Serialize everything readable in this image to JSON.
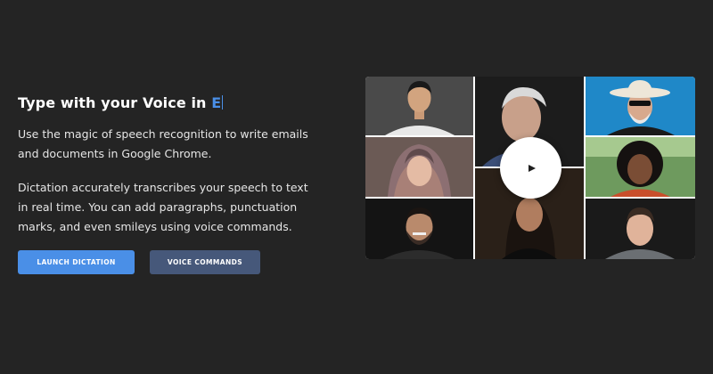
{
  "hero": {
    "headline": "Type with your Voice in",
    "typed_text": "E",
    "paragraph_1": "Use the magic of speech recognition to write emails and documents in Google Chrome.",
    "paragraph_2": "Dictation accurately transcribes your speech to text in real time. You can add paragraphs, punctuation marks, and even smileys using voice commands."
  },
  "actions": {
    "launch_label": "LAUNCH DICTATION",
    "commands_label": "VOICE COMMANDS"
  },
  "video": {
    "play_icon": "play-icon",
    "tiles": [
      "young-man-portrait",
      "elderly-man-portrait",
      "man-in-cowboy-hat-portrait",
      "woman-in-headscarf-portrait",
      "woman-with-curly-hair-portrait",
      "smiling-bearded-man-portrait",
      "woman-with-long-hair-portrait",
      "young-man-short-hair-portrait"
    ]
  },
  "colors": {
    "background": "#242424",
    "accent": "#4a8fe7",
    "secondary_button": "#46587a"
  }
}
